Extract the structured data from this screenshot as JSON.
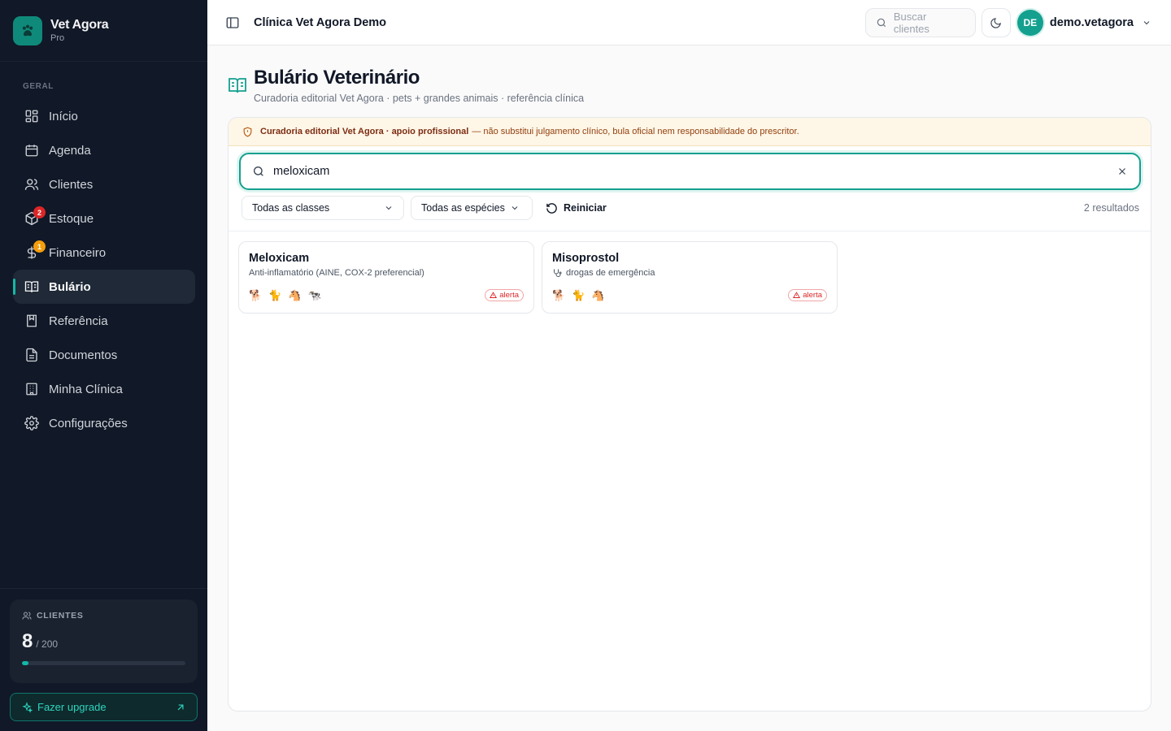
{
  "brand": {
    "name": "Vet Agora",
    "plan": "Pro"
  },
  "sidebar": {
    "section_label": "GERAL",
    "items": [
      {
        "label": "Início",
        "icon": "dashboard-icon"
      },
      {
        "label": "Agenda",
        "icon": "calendar-icon"
      },
      {
        "label": "Clientes",
        "icon": "users-icon"
      },
      {
        "label": "Estoque",
        "icon": "package-icon",
        "badge": "2"
      },
      {
        "label": "Financeiro",
        "icon": "dollar-icon",
        "badge": "1"
      },
      {
        "label": "Bulário",
        "icon": "book-icon",
        "active": true
      },
      {
        "label": "Referência",
        "icon": "bookmark-book-icon"
      },
      {
        "label": "Documentos",
        "icon": "file-icon"
      },
      {
        "label": "Minha Clínica",
        "icon": "building-icon"
      },
      {
        "label": "Configurações",
        "icon": "gear-icon"
      }
    ],
    "usage": {
      "label": "CLIENTES",
      "count": "8",
      "total": "/ 200",
      "fraction": 0.04
    },
    "upgrade_label": "Fazer upgrade"
  },
  "topbar": {
    "clinic_name": "Clínica Vet Agora Demo",
    "search_placeholder": "Buscar clientes",
    "user_initials": "DE",
    "user_name": "demo.vetagora"
  },
  "page": {
    "title": "Bulário Veterinário",
    "subtitle": "Curadoria editorial Vet Agora · pets + grandes animais · referência clínica"
  },
  "disclaimer": {
    "bold": "Curadoria editorial Vet Agora · apoio profissional",
    "rest": "— não substitui julgamento clínico, bula oficial nem responsabilidade do prescritor."
  },
  "search": {
    "value": "meloxicam"
  },
  "filters": {
    "classes": "Todas as classes",
    "species": "Todas as espécies",
    "reset": "Reiniciar",
    "result_count": "2 resultados"
  },
  "results": [
    {
      "name": "Meloxicam",
      "description": "Anti-inflamatório (AINE, COX-2 preferencial)",
      "species": [
        "🐕",
        "🐈",
        "🐴",
        "🐄"
      ],
      "alert": "alerta"
    },
    {
      "name": "Misoprostol",
      "description": "drogas de emergência",
      "species": [
        "🐕",
        "🐈",
        "🐴"
      ],
      "alert": "alerta"
    }
  ],
  "colors": {
    "accent": "#14a08f",
    "sidebar_bg": "#111827",
    "alert": "#dc2626",
    "warning_bg": "#fef6e7"
  }
}
